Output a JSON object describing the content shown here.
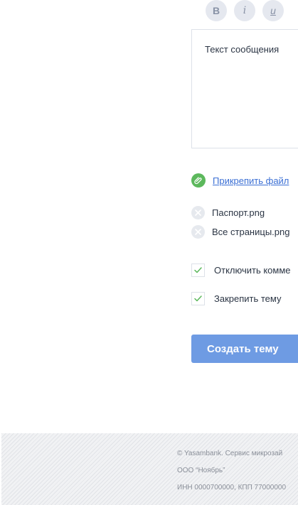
{
  "editor": {
    "toolbar": {
      "bold_label": "B",
      "italic_label": "i",
      "underline_label": "u"
    },
    "placeholder": "Текст сообщения"
  },
  "attachments": {
    "attach_label": "Прикрепить файл",
    "files": [
      "Паспорт.png",
      "Все страницы.png"
    ]
  },
  "options": {
    "disable_comments_label": "Отключить комме",
    "disable_comments_checked": true,
    "pin_topic_label": "Закрепить тему",
    "pin_topic_checked": true
  },
  "submit_label": "Создать тему",
  "footer": {
    "line1": "© Yasambank. Сервис микрозай",
    "line2": "ООО “Ноябрь”",
    "line3": "ИНН 0000700000, КПП 77000000"
  },
  "colors": {
    "accent": "#6e9be3",
    "link": "#3b6fd4",
    "attach_icon_bg": "#5cb85c",
    "check": "#5cb85c"
  }
}
